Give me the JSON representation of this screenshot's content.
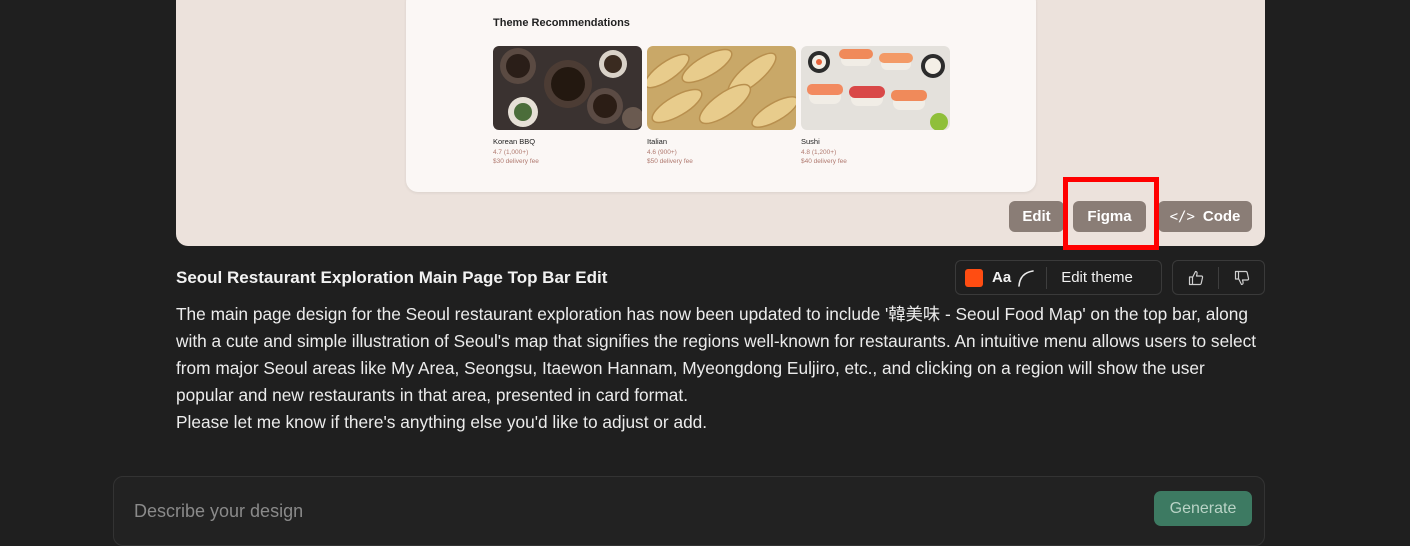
{
  "preview": {
    "section_title": "Theme Recommendations",
    "themes": [
      {
        "name": "Korean BBQ",
        "rating": "4.7 (1,000+)",
        "fee": "$30 delivery fee"
      },
      {
        "name": "Italian",
        "rating": "4.6 (900+)",
        "fee": "$50 delivery fee"
      },
      {
        "name": "Sushi",
        "rating": "4.8 (1,200+)",
        "fee": "$40 delivery fee"
      }
    ],
    "buttons": {
      "edit": "Edit",
      "figma": "Figma",
      "code": "Code"
    }
  },
  "message": {
    "title": "Seoul Restaurant Exploration Main Page Top Bar Edit",
    "body_1": "The main page design for the Seoul restaurant exploration has now been updated to include '韓美味 - Seoul Food Map' on the top bar, along with a cute and simple illustration of Seoul's map that signifies the regions well-known for restaurants. An intuitive menu allows users to select from major Seoul areas like My Area, Seongsu, Itaewon Hannam, Myeongdong Euljiro, etc., and clicking on a region will show the user popular and new restaurants in that area, presented in card format.",
    "body_2": "Please let me know if there's anything else you'd like to adjust or add."
  },
  "theme_bar": {
    "font_label": "Aa",
    "edit_theme": "Edit theme",
    "swatch_color": "#ff4d12"
  },
  "composer": {
    "placeholder": "Describe your design",
    "generate": "Generate"
  }
}
